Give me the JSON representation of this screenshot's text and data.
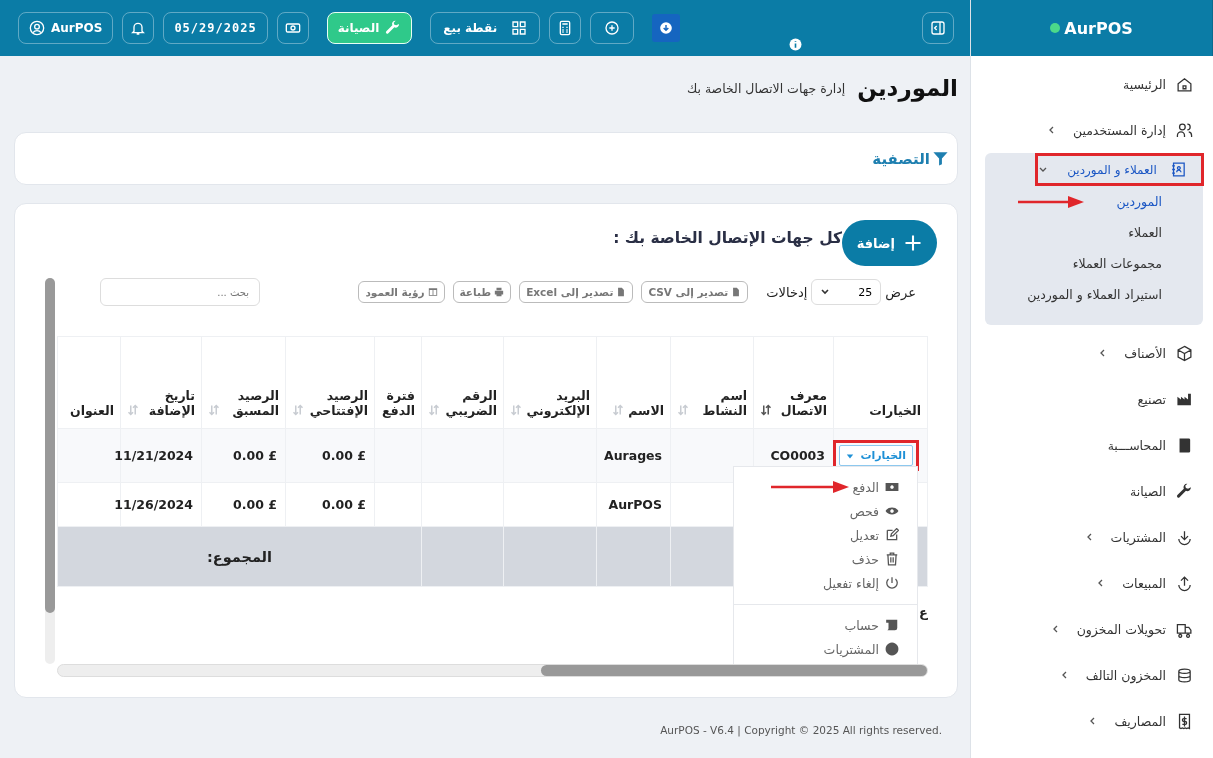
{
  "topbar": {
    "profile_button": {
      "label": "AurPOS"
    },
    "date": "05/29/2025",
    "maintenance_button": {
      "label": "الصيانة"
    },
    "pos_button": {
      "label": "نقطة بيع"
    }
  },
  "sidebar": {
    "brand": "AurPOS",
    "items": [
      {
        "label": "الرئيسية",
        "has_children": false,
        "expanded": false,
        "selected": false
      },
      {
        "label": "إدارة المستخدمين",
        "has_children": true,
        "expanded": false,
        "selected": false
      },
      {
        "label": "العملاء و الموردين",
        "has_children": true,
        "expanded": true,
        "selected": true,
        "annotated": true,
        "children": [
          {
            "label": "الموردين",
            "selected": true,
            "annotated": true
          },
          {
            "label": "العملاء",
            "selected": false,
            "annotated": false
          },
          {
            "label": "مجموعات العملاء",
            "selected": false,
            "annotated": false
          },
          {
            "label": "استيراد العملاء و الموردين",
            "selected": false,
            "annotated": false
          }
        ]
      },
      {
        "label": "الأصناف",
        "has_children": true,
        "expanded": false,
        "selected": false
      },
      {
        "label": "تصنيع",
        "has_children": false,
        "expanded": false,
        "selected": false
      },
      {
        "label": "المحاســـبة",
        "has_children": false,
        "expanded": false,
        "selected": false
      },
      {
        "label": "الصيانة",
        "has_children": false,
        "expanded": false,
        "selected": false
      },
      {
        "label": "المشتريات",
        "has_children": true,
        "expanded": false,
        "selected": false
      },
      {
        "label": "المبيعات",
        "has_children": true,
        "expanded": false,
        "selected": false
      },
      {
        "label": "تحويلات المخزون",
        "has_children": true,
        "expanded": false,
        "selected": false
      },
      {
        "label": "المخزون التالف",
        "has_children": true,
        "expanded": false,
        "selected": false
      },
      {
        "label": "المصاريف",
        "has_children": true,
        "expanded": false,
        "selected": false
      }
    ]
  },
  "page": {
    "title": "الموردين",
    "subtitle": "إدارة جهات الاتصال الخاصة بك"
  },
  "filter": {
    "title": "التصفية"
  },
  "card": {
    "title": "كل جهات الإتصال الخاصة بك :",
    "add_button": {
      "label": "إضافة"
    },
    "show_label": "عرض",
    "page_size": "25",
    "entries_label": "إدخالات",
    "export_buttons": [
      {
        "label": "تصدير إلى CSV"
      },
      {
        "label": "تصدير إلى Excel"
      },
      {
        "label": "طباعة"
      },
      {
        "label": "رؤية العمود"
      }
    ],
    "search": {
      "placeholder": "بحث ..."
    },
    "table": {
      "columns": [
        {
          "label": "الخيارات",
          "sortable": false
        },
        {
          "label": "معرف الاتصال",
          "sortable": true,
          "sorted": true
        },
        {
          "label": "اسم النشاط",
          "sortable": true,
          "sorted": false
        },
        {
          "label": "الاسم",
          "sortable": true,
          "sorted": false
        },
        {
          "label": "البريد الإلكتروني",
          "sortable": true,
          "sorted": false
        },
        {
          "label": "الرقم الضريبي",
          "sortable": true,
          "sorted": false
        },
        {
          "label": "فترة الدفع",
          "sortable": false
        },
        {
          "label": "الرصيد الإفتتاحي",
          "sortable": true,
          "sorted": false
        },
        {
          "label": "الرصيد المسبق",
          "sortable": true,
          "sorted": false
        },
        {
          "label": "تاريخ الإضافة",
          "sortable": true,
          "sorted": false
        },
        {
          "label": "العنوان",
          "sortable": false
        }
      ],
      "rows": [
        {
          "highlighted": true,
          "options_annotated": true,
          "cells": [
            "الخيارات",
            "CO0003",
            "",
            "Aurages",
            "",
            "",
            "",
            "0.00 £",
            "0.00 £",
            "11/21/2024",
            ""
          ]
        },
        {
          "highlighted": false,
          "cells": [
            "",
            "",
            "",
            "AurPOS",
            "",
            "",
            "",
            "0.00 £",
            "0.00 £",
            "11/26/2024",
            ""
          ]
        }
      ],
      "total_label": "المجموع:"
    },
    "options_menu": {
      "groups": [
        [
          {
            "label": "الدفع",
            "annotated": true
          },
          {
            "label": "فحص",
            "annotated": false
          },
          {
            "label": "تعديل",
            "annotated": false
          },
          {
            "label": "حذف",
            "annotated": false
          },
          {
            "label": "إلغاء تفعيل",
            "annotated": false
          }
        ],
        [
          {
            "label": "حساب",
            "annotated": false
          },
          {
            "label": "المشتريات",
            "annotated": false
          }
        ]
      ]
    },
    "bottom_label": "ع"
  },
  "footer": {
    "text": "AurPOS - V6.4 | Copyright © 2025 All rights reserved."
  }
}
